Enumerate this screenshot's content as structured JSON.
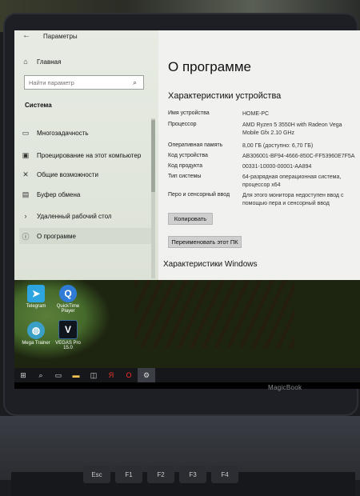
{
  "window": {
    "back_icon": "back-arrow-icon",
    "title": "Параметры"
  },
  "sidebar": {
    "home_label": "Главная",
    "search_placeholder": "Найти параметр",
    "section_title": "Система",
    "items": [
      {
        "label": "Многозадачность",
        "icon": "multitask-icon"
      },
      {
        "label": "Проецирование на этот компьютер",
        "icon": "projecting-icon"
      },
      {
        "label": "Общие возможности",
        "icon": "shared-experiences-icon"
      },
      {
        "label": "Буфер обмена",
        "icon": "clipboard-icon"
      },
      {
        "label": "Удаленный рабочий стол",
        "icon": "remote-desktop-icon"
      },
      {
        "label": "О программе",
        "icon": "info-icon",
        "active": true
      }
    ]
  },
  "main": {
    "page_title": "О программе",
    "device_specs_title": "Характеристики устройства",
    "specs": [
      {
        "label": "Имя устройства",
        "value": "HOME-PC"
      },
      {
        "label": "Процессор",
        "value": "AMD Ryzen 5 3550H with Radeon Vega Mobile Gfx     2.10 GHz"
      },
      {
        "label": "Оперативная память",
        "value": "8,00 ГБ (доступно: 6,70 ГБ)"
      },
      {
        "label": "Код устройства",
        "value": "AB306001-BF94-4666-850C-FF53960E7F5A"
      },
      {
        "label": "Код продукта",
        "value": "00331-10000-00001-AA894"
      },
      {
        "label": "Тип системы",
        "value": "64-разрядная операционная система, процессор x64"
      },
      {
        "label": "Перо и сенсорный ввод",
        "value": "Для этого монитора недоступен ввод с помощью пера и сенсорный ввод"
      }
    ],
    "copy_button": "Копировать",
    "rename_button": "Переименовать этот ПК",
    "windows_specs_title": "Характеристики Windows"
  },
  "desktop": {
    "icons": [
      {
        "label": "Telegram",
        "icon": "telegram-icon",
        "color": "#2ca5e0"
      },
      {
        "label": "QuickTime Player",
        "icon": "quicktime-icon",
        "color": "#2f7bd6"
      },
      {
        "label": "Mega Trainer",
        "icon": "globe-icon",
        "color": "#3aa0c8"
      },
      {
        "label": "VEGAS Pro 15.0",
        "icon": "vegas-icon",
        "color": "#10151d"
      }
    ]
  },
  "taskbar": {
    "items": [
      "windows-start-icon",
      "search-icon",
      "task-view-icon",
      "file-explorer-icon",
      "store-icon",
      "yandex-browser-icon",
      "opera-icon",
      "settings-gear-icon"
    ]
  },
  "laptop": {
    "brand": "MagicBook",
    "keys": [
      "Esc",
      "F1",
      "F2",
      "F3",
      "F4"
    ]
  },
  "colors": {
    "sidebar_bg": "#e3e8df",
    "main_bg": "#f1f1f0",
    "button_bg": "#cfcfcf",
    "taskbar_bg": "#16171a"
  }
}
